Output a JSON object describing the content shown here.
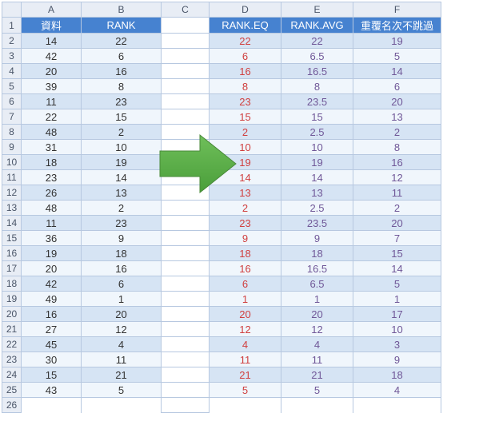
{
  "columns": [
    "A",
    "B",
    "C",
    "D",
    "E",
    "F"
  ],
  "headers": {
    "A": "資料",
    "B": "RANK",
    "D": "RANK.EQ",
    "E": "RANK.AVG",
    "F": "重覆名次不跳過"
  },
  "rows": [
    {
      "n": 1
    },
    {
      "n": 2,
      "a": "14",
      "b": "22",
      "d": "22",
      "e": "22",
      "f": "19"
    },
    {
      "n": 3,
      "a": "42",
      "b": "6",
      "d": "6",
      "e": "6.5",
      "f": "5"
    },
    {
      "n": 4,
      "a": "20",
      "b": "16",
      "d": "16",
      "e": "16.5",
      "f": "14"
    },
    {
      "n": 5,
      "a": "39",
      "b": "8",
      "d": "8",
      "e": "8",
      "f": "6"
    },
    {
      "n": 6,
      "a": "11",
      "b": "23",
      "d": "23",
      "e": "23.5",
      "f": "20"
    },
    {
      "n": 7,
      "a": "22",
      "b": "15",
      "d": "15",
      "e": "15",
      "f": "13"
    },
    {
      "n": 8,
      "a": "48",
      "b": "2",
      "d": "2",
      "e": "2.5",
      "f": "2"
    },
    {
      "n": 9,
      "a": "31",
      "b": "10",
      "d": "10",
      "e": "10",
      "f": "8"
    },
    {
      "n": 10,
      "a": "18",
      "b": "19",
      "d": "19",
      "e": "19",
      "f": "16"
    },
    {
      "n": 11,
      "a": "23",
      "b": "14",
      "d": "14",
      "e": "14",
      "f": "12"
    },
    {
      "n": 12,
      "a": "26",
      "b": "13",
      "d": "13",
      "e": "13",
      "f": "11"
    },
    {
      "n": 13,
      "a": "48",
      "b": "2",
      "d": "2",
      "e": "2.5",
      "f": "2"
    },
    {
      "n": 14,
      "a": "11",
      "b": "23",
      "d": "23",
      "e": "23.5",
      "f": "20"
    },
    {
      "n": 15,
      "a": "36",
      "b": "9",
      "d": "9",
      "e": "9",
      "f": "7"
    },
    {
      "n": 16,
      "a": "19",
      "b": "18",
      "d": "18",
      "e": "18",
      "f": "15"
    },
    {
      "n": 17,
      "a": "20",
      "b": "16",
      "d": "16",
      "e": "16.5",
      "f": "14"
    },
    {
      "n": 18,
      "a": "42",
      "b": "6",
      "d": "6",
      "e": "6.5",
      "f": "5"
    },
    {
      "n": 19,
      "a": "49",
      "b": "1",
      "d": "1",
      "e": "1",
      "f": "1"
    },
    {
      "n": 20,
      "a": "16",
      "b": "20",
      "d": "20",
      "e": "20",
      "f": "17"
    },
    {
      "n": 21,
      "a": "27",
      "b": "12",
      "d": "12",
      "e": "12",
      "f": "10"
    },
    {
      "n": 22,
      "a": "45",
      "b": "4",
      "d": "4",
      "e": "4",
      "f": "3"
    },
    {
      "n": 23,
      "a": "30",
      "b": "11",
      "d": "11",
      "e": "11",
      "f": "9"
    },
    {
      "n": 24,
      "a": "15",
      "b": "21",
      "d": "21",
      "e": "21",
      "f": "18"
    },
    {
      "n": 25,
      "a": "43",
      "b": "5",
      "d": "5",
      "e": "5",
      "f": "4"
    },
    {
      "n": 26
    }
  ],
  "chart_data": {
    "type": "table",
    "title": "Ranking formulas comparison",
    "columns": [
      "資料",
      "RANK",
      "RANK.EQ",
      "RANK.AVG",
      "重覆名次不跳過"
    ],
    "rows": [
      [
        14,
        22,
        22,
        22,
        19
      ],
      [
        42,
        6,
        6,
        6.5,
        5
      ],
      [
        20,
        16,
        16,
        16.5,
        14
      ],
      [
        39,
        8,
        8,
        8,
        6
      ],
      [
        11,
        23,
        23,
        23.5,
        20
      ],
      [
        22,
        15,
        15,
        15,
        13
      ],
      [
        48,
        2,
        2,
        2.5,
        2
      ],
      [
        31,
        10,
        10,
        10,
        8
      ],
      [
        18,
        19,
        19,
        19,
        16
      ],
      [
        23,
        14,
        14,
        14,
        12
      ],
      [
        26,
        13,
        13,
        13,
        11
      ],
      [
        48,
        2,
        2,
        2.5,
        2
      ],
      [
        11,
        23,
        23,
        23.5,
        20
      ],
      [
        36,
        9,
        9,
        9,
        7
      ],
      [
        19,
        18,
        18,
        18,
        15
      ],
      [
        20,
        16,
        16,
        16.5,
        14
      ],
      [
        42,
        6,
        6,
        6.5,
        5
      ],
      [
        49,
        1,
        1,
        1,
        1
      ],
      [
        16,
        20,
        20,
        20,
        17
      ],
      [
        27,
        12,
        12,
        12,
        10
      ],
      [
        45,
        4,
        4,
        4,
        3
      ],
      [
        30,
        11,
        11,
        11,
        9
      ],
      [
        15,
        21,
        21,
        21,
        18
      ],
      [
        43,
        5,
        5,
        5,
        4
      ]
    ]
  }
}
